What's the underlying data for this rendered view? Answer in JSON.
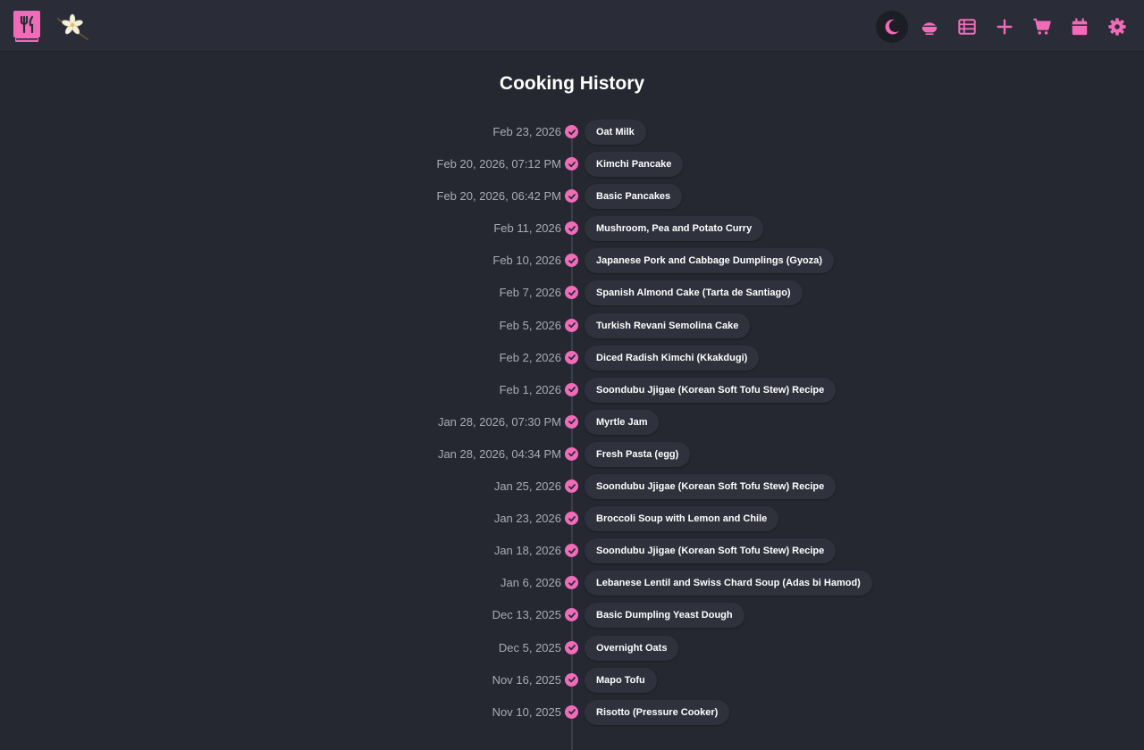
{
  "app": {
    "accent": "#f06cb8",
    "background": "#252731",
    "logo_icon": "cookbook-icon",
    "flower_icon": "flower-icon"
  },
  "nav": [
    {
      "icon": "moon-icon",
      "active": true
    },
    {
      "icon": "pot-icon",
      "active": false
    },
    {
      "icon": "table-icon",
      "active": false
    },
    {
      "icon": "plus-icon",
      "active": false
    },
    {
      "icon": "cart-icon",
      "active": false
    },
    {
      "icon": "calendar-icon",
      "active": false
    },
    {
      "icon": "gear-icon",
      "active": false
    }
  ],
  "page": {
    "title": "Cooking History"
  },
  "history": [
    {
      "date": "Feb 23, 2026",
      "recipe": "Oat Milk"
    },
    {
      "date": "Feb 20, 2026, 07:12 PM",
      "recipe": "Kimchi Pancake"
    },
    {
      "date": "Feb 20, 2026, 06:42 PM",
      "recipe": "Basic Pancakes"
    },
    {
      "date": "Feb 11, 2026",
      "recipe": "Mushroom, Pea and Potato Curry"
    },
    {
      "date": "Feb 10, 2026",
      "recipe": "Japanese Pork and Cabbage Dumplings (Gyoza)"
    },
    {
      "date": "Feb 7, 2026",
      "recipe": "Spanish Almond Cake (Tarta de Santiago)"
    },
    {
      "date": "Feb 5, 2026",
      "recipe": "Turkish Revani Semolina Cake"
    },
    {
      "date": "Feb 2, 2026",
      "recipe": "Diced Radish Kimchi (Kkakdugi)"
    },
    {
      "date": "Feb 1, 2026",
      "recipe": "Soondubu Jjigae (Korean Soft Tofu Stew) Recipe"
    },
    {
      "date": "Jan 28, 2026, 07:30 PM",
      "recipe": "Myrtle Jam"
    },
    {
      "date": "Jan 28, 2026, 04:34 PM",
      "recipe": "Fresh Pasta (egg)"
    },
    {
      "date": "Jan 25, 2026",
      "recipe": "Soondubu Jjigae (Korean Soft Tofu Stew) Recipe"
    },
    {
      "date": "Jan 23, 2026",
      "recipe": "Broccoli Soup with Lemon and Chile"
    },
    {
      "date": "Jan 18, 2026",
      "recipe": "Soondubu Jjigae (Korean Soft Tofu Stew) Recipe"
    },
    {
      "date": "Jan 6, 2026",
      "recipe": "Lebanese Lentil and Swiss Chard Soup (Adas bi Hamod)"
    },
    {
      "date": "Dec 13, 2025",
      "recipe": "Basic Dumpling Yeast Dough"
    },
    {
      "date": "Dec 5, 2025",
      "recipe": "Overnight Oats"
    },
    {
      "date": "Nov 16, 2025",
      "recipe": "Mapo Tofu"
    },
    {
      "date": "Nov 10, 2025",
      "recipe": "Risotto (Pressure Cooker)"
    }
  ]
}
